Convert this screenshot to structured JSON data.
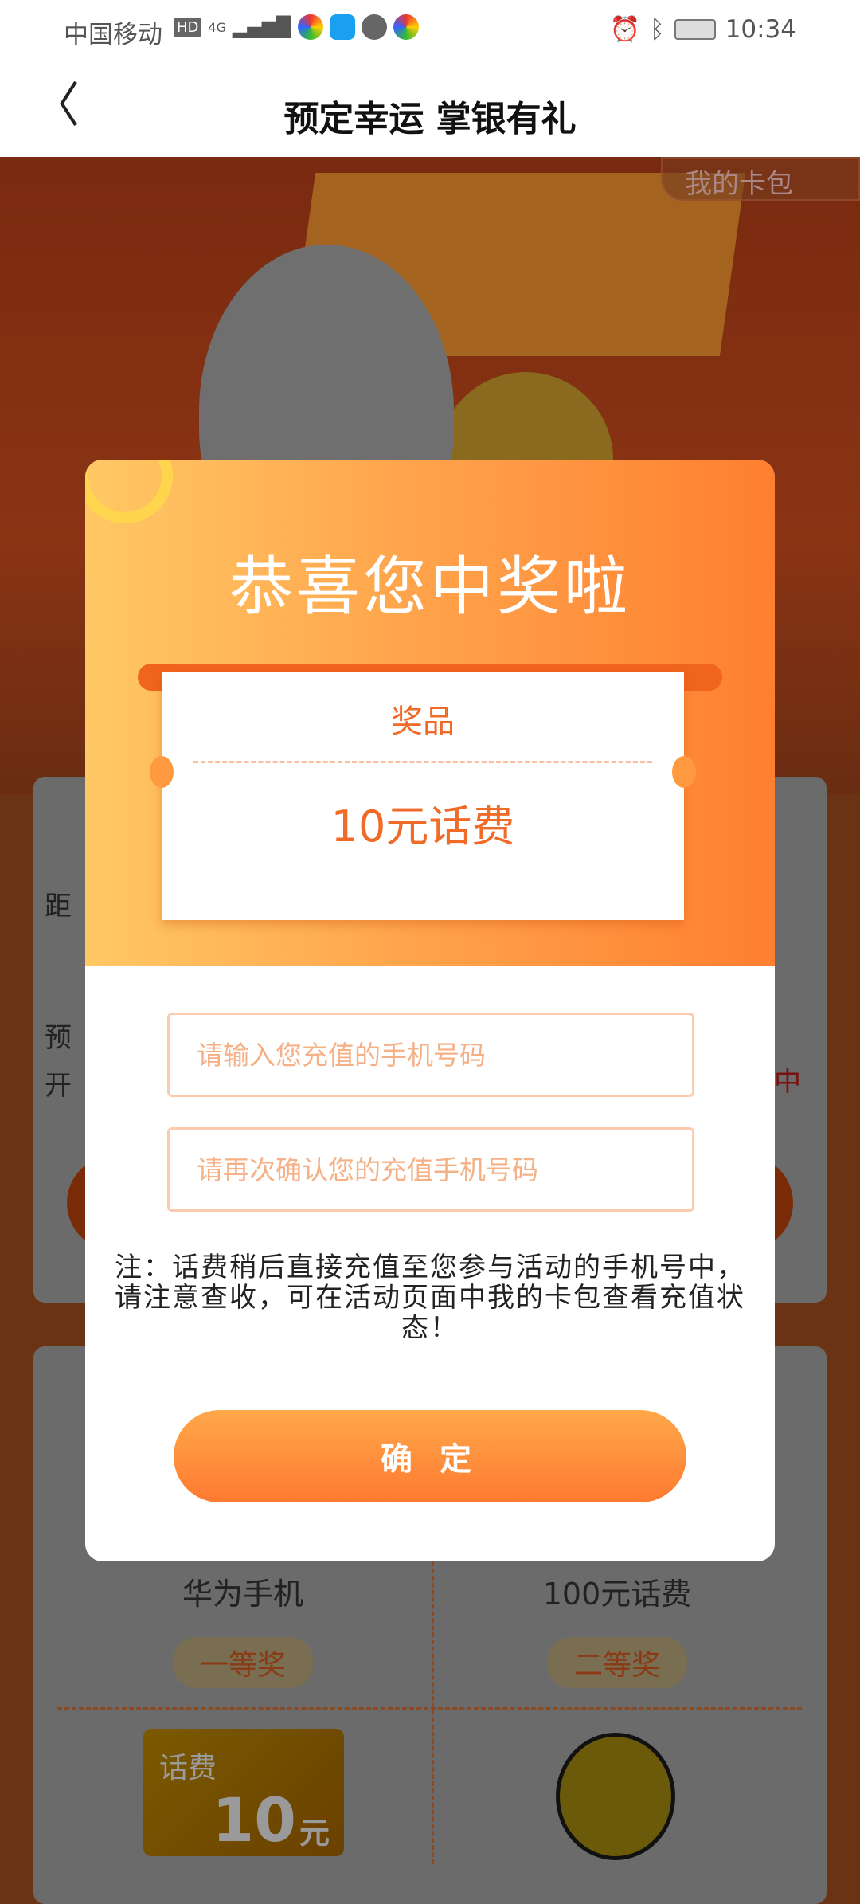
{
  "status_bar": {
    "carrier": "中国移动",
    "network": "4G",
    "time": "10:34"
  },
  "header": {
    "title": "预定幸运 掌银有礼",
    "back_icon": "chevron-left-icon"
  },
  "background": {
    "my_card_pack": "我的卡包",
    "card1_fragments": [
      "距",
      "预",
      "开",
      "中"
    ],
    "prizes": [
      {
        "name": "华为手机",
        "rank": "一等奖"
      },
      {
        "name": "100元话费",
        "rank": "二等奖"
      }
    ],
    "coupon": {
      "label": "话费",
      "amount": "10",
      "unit": "元"
    }
  },
  "modal": {
    "title": "恭喜您中奖啦",
    "prize_label": "奖品",
    "prize_value": "10元话费",
    "phone_placeholder": "请输入您充值的手机号码",
    "confirm_phone_placeholder": "请再次确认您的充值手机号码",
    "note": "注：话费稍后直接充值至您参与活动的手机号中，请注意查收，可在活动页面中我的卡包查看充值状态！",
    "confirm_label": "确 定"
  },
  "colors": {
    "accent": "#ff7f30",
    "ticket_text": "#f06a28",
    "input_border": "#fbcbb0"
  }
}
